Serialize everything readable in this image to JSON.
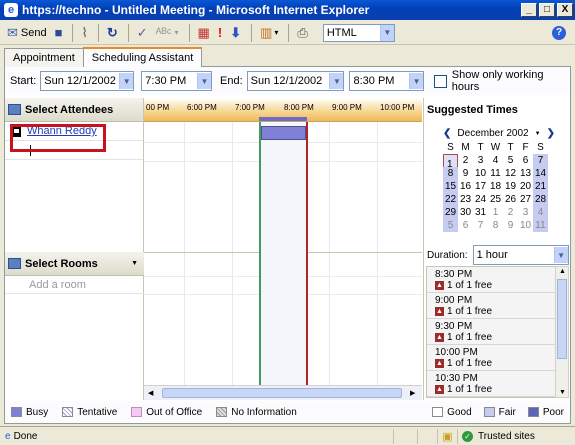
{
  "window": {
    "title": "https://techno - Untitled Meeting - Microsoft Internet Explorer",
    "minimize": "_",
    "maximize": "□",
    "close": "X"
  },
  "toolbar": {
    "send_label": "Send",
    "format_value": "HTML",
    "help_glyph": "?"
  },
  "tabs": [
    {
      "label": "Appointment"
    },
    {
      "label": "Scheduling Assistant"
    }
  ],
  "times": {
    "start_label": "Start:",
    "start_date": "Sun 12/1/2002",
    "start_time": "7:30 PM",
    "end_label": "End:",
    "end_date": "Sun 12/1/2002",
    "end_time": "8:30 PM",
    "working_hours_label": "Show only working hours"
  },
  "attendees": {
    "header": "Select Attendees",
    "items": [
      {
        "name": "Whann Reddy"
      }
    ]
  },
  "rooms": {
    "header": "Select Rooms",
    "add_placeholder": "Add a room"
  },
  "grid": {
    "hours": [
      "00 PM",
      "6:00 PM",
      "7:00 PM",
      "8:00 PM",
      "9:00 PM",
      "10:00 PM"
    ]
  },
  "suggested": {
    "header": "Suggested Times",
    "month": "December 2002",
    "weekdays": [
      "S",
      "M",
      "T",
      "W",
      "T",
      "F",
      "S"
    ],
    "weeks": [
      [
        "1",
        "2",
        "3",
        "4",
        "5",
        "6",
        "7"
      ],
      [
        "8",
        "9",
        "10",
        "11",
        "12",
        "13",
        "14"
      ],
      [
        "15",
        "16",
        "17",
        "18",
        "19",
        "20",
        "21"
      ],
      [
        "22",
        "23",
        "24",
        "25",
        "26",
        "27",
        "28"
      ],
      [
        "29",
        "30",
        "31",
        "1",
        "2",
        "3",
        "4"
      ],
      [
        "5",
        "6",
        "7",
        "8",
        "9",
        "10",
        "11"
      ]
    ],
    "duration_label": "Duration:",
    "duration_value": "1 hour",
    "times": [
      {
        "time": "8:30 PM",
        "free": "1 of 1 free"
      },
      {
        "time": "9:00 PM",
        "free": "1 of 1 free"
      },
      {
        "time": "9:30 PM",
        "free": "1 of 1 free"
      },
      {
        "time": "10:00 PM",
        "free": "1 of 1 free"
      },
      {
        "time": "10:30 PM",
        "free": "1 of 1 free"
      }
    ]
  },
  "legend": {
    "busy": "Busy",
    "tentative": "Tentative",
    "out_of_office": "Out of Office",
    "no_information": "No Information",
    "good": "Good",
    "fair": "Fair",
    "poor": "Poor"
  },
  "status": {
    "left": "Done",
    "zone": "Trusted sites"
  },
  "colors": {
    "busy": "#8080d8",
    "start_line": "#3aa05c",
    "end_line": "#b02424",
    "highlight_box": "#c8121c"
  }
}
